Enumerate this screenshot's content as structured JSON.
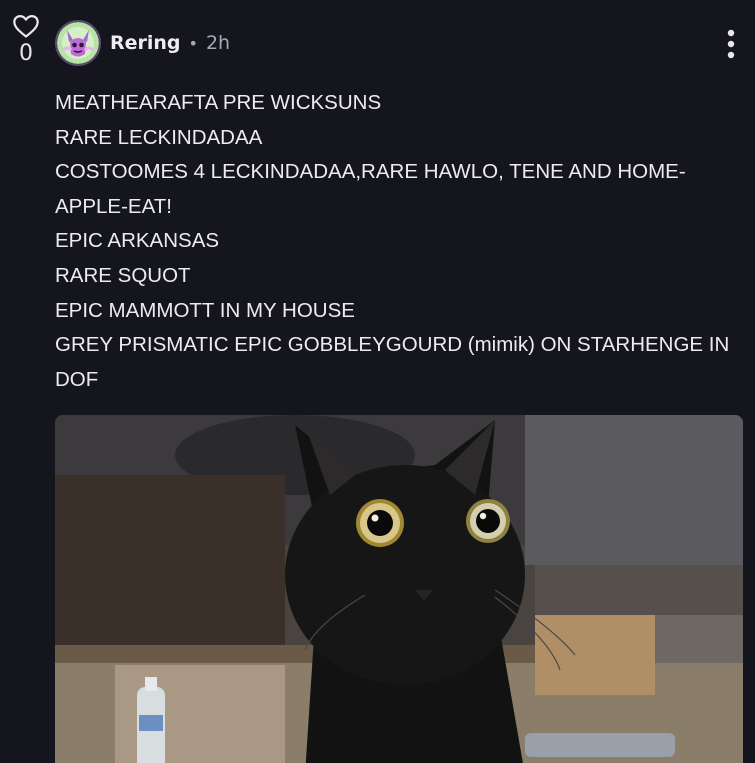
{
  "post": {
    "vote_count": "0",
    "author": "Rering",
    "separator": "•",
    "time": "2h",
    "lines": [
      "MEATHEARAFTA PRE WICKSUNS",
      "RARE LECKINDADAA",
      "COSTOOMES 4 LECKINDADAA,RARE HAWLO,  TENE AND HOME-APPLE-EAT!",
      "EPIC ARKANSAS",
      "RARE SQUOT",
      "EPIC MAMMOTT IN MY HOUSE",
      "GREY PRISMATIC EPIC GOBBLEYGOURD (mimik) ON STARHENGE IN DOF"
    ]
  },
  "icons": {
    "like": "heart-outline-icon",
    "menu": "vertical-ellipsis-icon"
  },
  "colors": {
    "background": "#15151d",
    "text": "#ececf0",
    "muted": "#a8a8b4"
  }
}
